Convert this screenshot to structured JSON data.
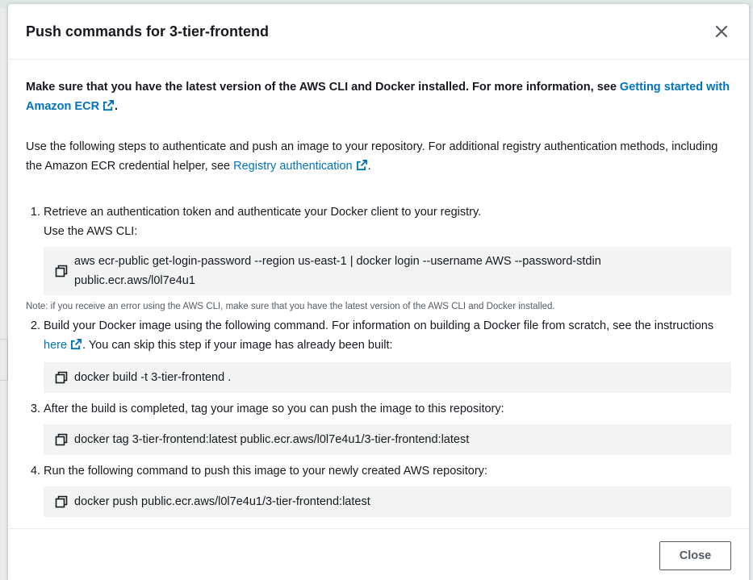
{
  "modal": {
    "title": "Push commands for 3-tier-frontend",
    "intro_bold": "Make sure that you have the latest version of the AWS CLI and Docker installed. For more information, see ",
    "intro_link": "Getting started with Amazon ECR",
    "intro_end": ".",
    "para2_text": "Use the following steps to authenticate and push an image to your repository. For additional registry authentication methods, including the Amazon ECR credential helper, see ",
    "para2_link": "Registry authentication",
    "para2_end": ".",
    "steps": [
      {
        "text": "Retrieve an authentication token and authenticate your Docker client to your registry.",
        "sub_label": "Use the AWS CLI:",
        "command": "aws ecr-public get-login-password --region us-east-1 | docker login --username AWS --password-stdin public.ecr.aws/l0l7e4u1",
        "note": "Note: if you receive an error using the AWS CLI, make sure that you have the latest version of the AWS CLI and Docker installed."
      },
      {
        "text_before": "Build your Docker image using the following command. For information on building a Docker file from scratch, see the instructions ",
        "link": "here",
        "text_after": ". You can skip this step if your image has already been built:",
        "command": "docker build -t 3-tier-frontend ."
      },
      {
        "text": "After the build is completed, tag your image so you can push the image to this repository:",
        "command": "docker tag 3-tier-frontend:latest public.ecr.aws/l0l7e4u1/3-tier-frontend:latest"
      },
      {
        "text": "Run the following command to push this image to your newly created AWS repository:",
        "command": "docker push public.ecr.aws/l0l7e4u1/3-tier-frontend:latest"
      }
    ],
    "close_button": "Close"
  },
  "icons": {
    "close": "close-icon",
    "external_link": "external-link-icon",
    "copy": "copy-icon"
  },
  "colors": {
    "link": "#0073bb",
    "code_background": "#f2f3f3",
    "text": "#16191f"
  }
}
